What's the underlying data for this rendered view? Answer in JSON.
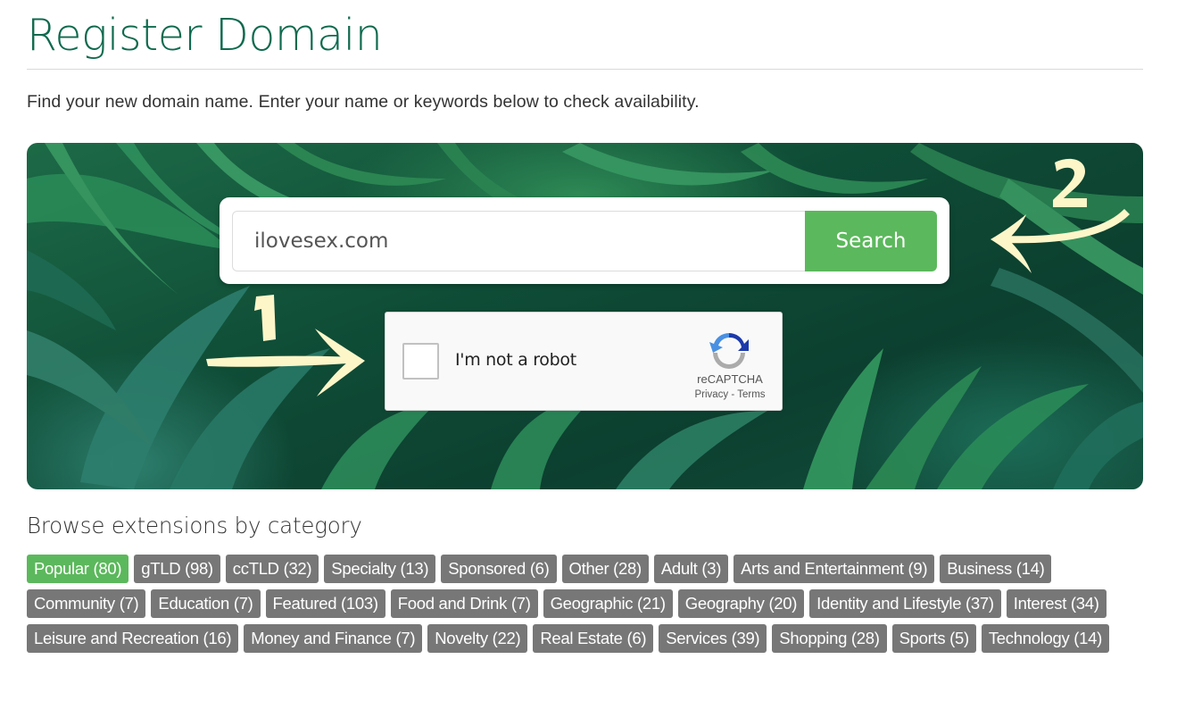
{
  "page": {
    "title": "Register Domain",
    "intro": "Find your new domain name. Enter your name or keywords below to check availability."
  },
  "search": {
    "value": "ilovesex.com",
    "button_label": "Search"
  },
  "recaptcha": {
    "label": "I'm not a robot",
    "brand": "reCAPTCHA",
    "privacy_link": "Privacy",
    "separator": "-",
    "terms_link": "Terms",
    "checked": false
  },
  "annotations": {
    "step1": "1",
    "step2": "2",
    "color": "#fdf6c9"
  },
  "browse": {
    "heading": "Browse extensions by category",
    "categories": [
      {
        "label": "Popular (80)",
        "active": true
      },
      {
        "label": "gTLD (98)"
      },
      {
        "label": "ccTLD (32)"
      },
      {
        "label": "Specialty (13)"
      },
      {
        "label": "Sponsored (6)"
      },
      {
        "label": "Other (28)"
      },
      {
        "label": "Adult (3)"
      },
      {
        "label": "Arts and Entertainment (9)"
      },
      {
        "label": "Business (14)"
      },
      {
        "label": "Community (7)"
      },
      {
        "label": "Education (7)"
      },
      {
        "label": "Featured (103)"
      },
      {
        "label": "Food and Drink (7)"
      },
      {
        "label": "Geographic (21)"
      },
      {
        "label": "Geography (20)"
      },
      {
        "label": "Identity and Lifestyle (37)"
      },
      {
        "label": "Interest (34)"
      },
      {
        "label": "Leisure and Recreation (16)"
      },
      {
        "label": "Money and Finance (7)"
      },
      {
        "label": "Novelty (22)"
      },
      {
        "label": "Real Estate (6)"
      },
      {
        "label": "Services (39)"
      },
      {
        "label": "Shopping (28)"
      },
      {
        "label": "Sports (5)"
      },
      {
        "label": "Technology (14)"
      }
    ]
  },
  "colors": {
    "title": "#0f6a4e",
    "accent": "#5cb85c",
    "tag": "#777777"
  }
}
